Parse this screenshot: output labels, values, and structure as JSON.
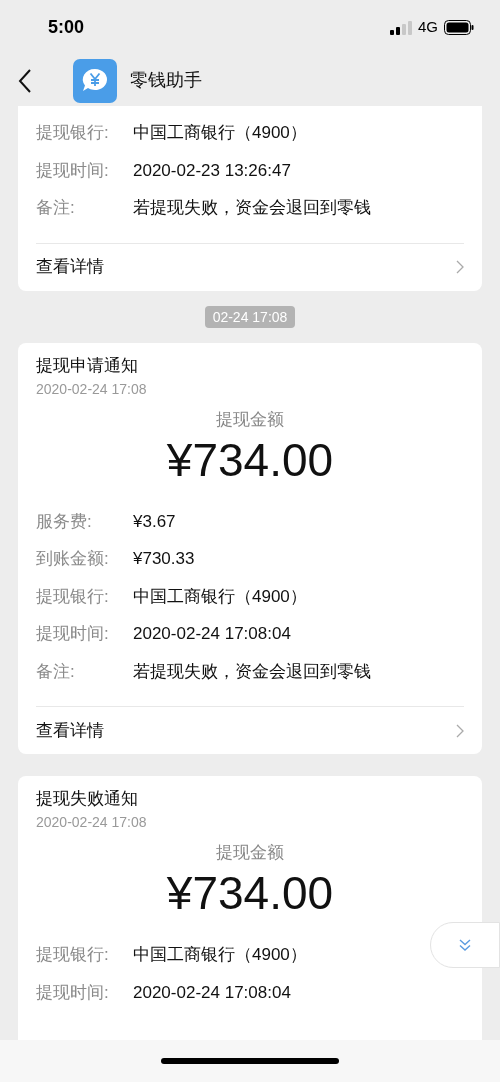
{
  "status_bar": {
    "time": "5:00",
    "network": "4G"
  },
  "nav": {
    "title": "零钱助手"
  },
  "messages": [
    {
      "kind": "card",
      "rows": [
        {
          "label": "提现银行:",
          "value": "中国工商银行（4900）"
        },
        {
          "label": "提现时间:",
          "value": "2020-02-23 13:26:47"
        },
        {
          "label": "备注:",
          "value": "若提现失败，资金会退回到零钱"
        }
      ],
      "link": "查看详情"
    },
    {
      "kind": "timestamp",
      "text": "02-24 17:08"
    },
    {
      "kind": "card",
      "title": "提现申请通知",
      "date": "2020-02-24 17:08",
      "amount_label": "提现金额",
      "amount": "¥734.00",
      "rows": [
        {
          "label": "服务费:",
          "value": "¥3.67"
        },
        {
          "label": "到账金额:",
          "value": "¥730.33"
        },
        {
          "label": "提现银行:",
          "value": "中国工商银行（4900）"
        },
        {
          "label": "提现时间:",
          "value": "2020-02-24 17:08:04"
        },
        {
          "label": "备注:",
          "value": "若提现失败，资金会退回到零钱"
        }
      ],
      "link": "查看详情"
    },
    {
      "kind": "card",
      "title": "提现失败通知",
      "date": "2020-02-24 17:08",
      "amount_label": "提现金额",
      "amount": "¥734.00",
      "rows": [
        {
          "label": "提现银行:",
          "value": "中国工商银行（4900）"
        },
        {
          "label": "提现时间:",
          "value": "2020-02-24 17:08:04"
        }
      ]
    }
  ]
}
